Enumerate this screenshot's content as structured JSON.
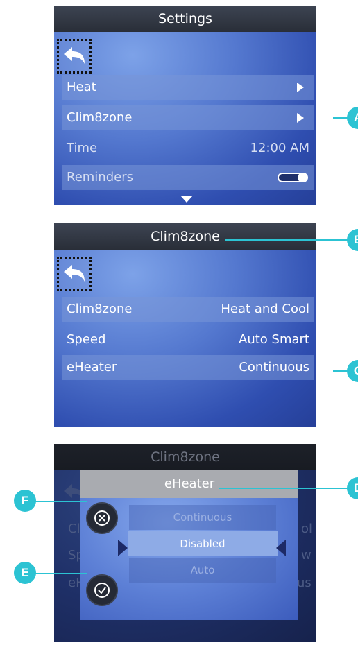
{
  "screen1": {
    "title": "Settings",
    "rows": [
      {
        "label": "Heat",
        "control": "arrow-right-icon"
      },
      {
        "label": "Clim8zone",
        "control": "arrow-right-icon"
      },
      {
        "label": "Time",
        "value": "12:00 AM"
      },
      {
        "label": "Reminders",
        "control": "toggle-on"
      }
    ]
  },
  "screen2": {
    "title": "Clim8zone",
    "rows": [
      {
        "label": "Clim8zone",
        "value": "Heat and Cool"
      },
      {
        "label": "Speed",
        "value": "Auto Smart"
      },
      {
        "label": "eHeater",
        "value": "Continuous"
      }
    ]
  },
  "screen3": {
    "title": "Clim8zone",
    "ghost_right": [
      "ol",
      "w",
      "us"
    ],
    "ghost_left": [
      "Cl",
      "Sp",
      "eH"
    ],
    "dialog": {
      "title": "eHeater",
      "options": [
        "Continuous",
        "Disabled",
        "Auto"
      ],
      "selected": "Disabled"
    }
  },
  "callouts": {
    "A": "A",
    "B": "B",
    "C": "C",
    "D": "D",
    "E": "E",
    "F": "F"
  },
  "colors": {
    "accent": "#2cc3d3",
    "titlebar": "#333a46",
    "screen_blue": "#3a5ab8"
  }
}
